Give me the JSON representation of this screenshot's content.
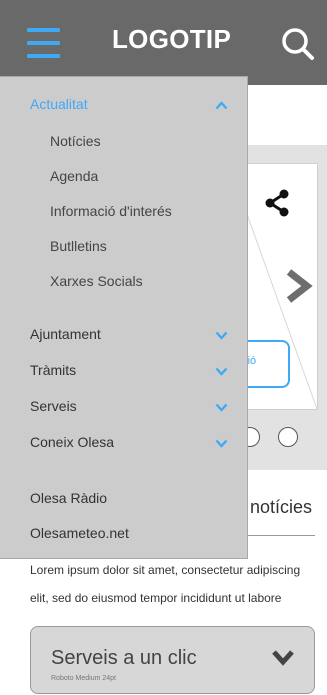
{
  "header": {
    "logo_text": "LOGOTIP"
  },
  "menu": {
    "sections": [
      {
        "label": "Actualitat",
        "expanded": true
      },
      {
        "label": "Ajuntament",
        "expanded": false
      },
      {
        "label": "Tràmits",
        "expanded": false
      },
      {
        "label": "Serveis",
        "expanded": false
      },
      {
        "label": "Coneix Olesa",
        "expanded": false
      }
    ],
    "subitems": [
      "Notícies",
      "Agenda",
      "Informació d'interés",
      "Butlletins",
      "Xarxes Socials"
    ],
    "links": [
      "Olesa Ràdio",
      "Olesameteo.net"
    ]
  },
  "slider": {
    "button_label": "ació"
  },
  "news": {
    "heading": "notícies"
  },
  "lorem": "Lorem ipsum dolor sit amet, consectetur adipiscing elit, sed do eiusmod tempor incididunt ut labore",
  "services": {
    "title": "Serveis a un clic",
    "subtitle": "Roboto Medium 24pt"
  },
  "colors": {
    "accent": "#3fa9f5",
    "header": "#696969",
    "menu_bg": "#cccccc"
  }
}
